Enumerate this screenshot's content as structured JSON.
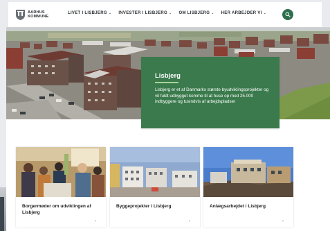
{
  "header": {
    "logo_line1": "AARHUS",
    "logo_line2": "KOMMUNE",
    "nav": [
      {
        "label": "LIVET I LISBJERG"
      },
      {
        "label": "INVESTER I LISBJERG"
      },
      {
        "label": "OM LISBJERG"
      },
      {
        "label": "HER ARBEJDER VI"
      }
    ],
    "accent_color": "#2f6f4d"
  },
  "info": {
    "title": "Lisbjerg",
    "body": "Lisbjerg er et af Danmarks største byudviklingsprojekter og vil fuldt udbygget komme til at huse op mod 25.000 indbyggere og tusindvis af arbejdspladser",
    "box_color": "#3a7a4c"
  },
  "cards": [
    {
      "title": "Borgermøder om udviklingen af Lisbjerg",
      "icon": "chevron-right-icon"
    },
    {
      "title": "Byggeprojekter i Lisbjerg",
      "icon": "chevron-right-icon"
    },
    {
      "title": "Anlægsarbejdet i Lisbjerg",
      "icon": "chevron-right-icon"
    }
  ]
}
